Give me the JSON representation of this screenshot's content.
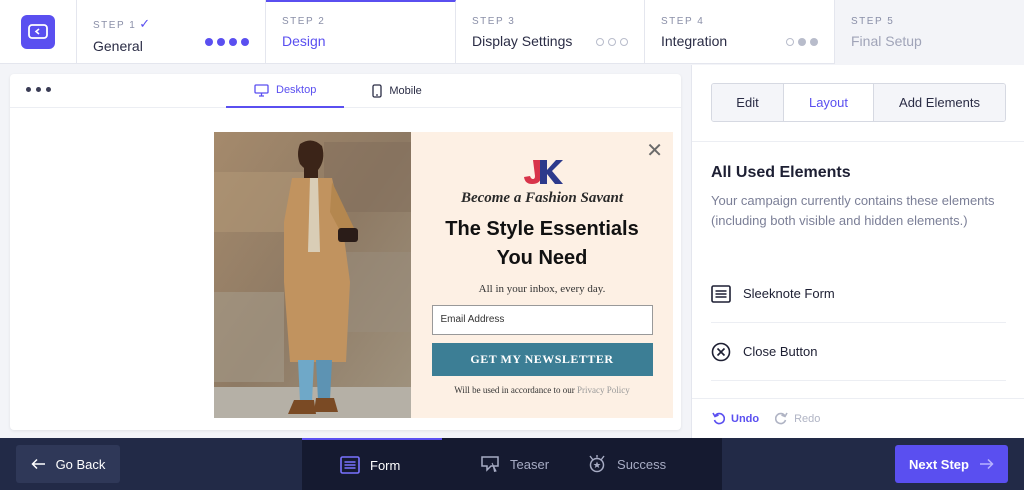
{
  "steps": [
    {
      "num": "STEP 1",
      "title": "General",
      "check": "✓"
    },
    {
      "num": "STEP 2",
      "title": "Design"
    },
    {
      "num": "STEP 3",
      "title": "Display Settings"
    },
    {
      "num": "STEP 4",
      "title": "Integration"
    },
    {
      "num": "STEP 5",
      "title": "Final Setup"
    }
  ],
  "preview": {
    "tabs": {
      "desktop": "Desktop",
      "mobile": "Mobile"
    },
    "popup": {
      "brand": "JK",
      "tagline": "Become a Fashion Savant",
      "headline_1": "The Style Essentials",
      "headline_2": "You Need",
      "sub": "All in your inbox, every day.",
      "email_placeholder": "Email Address",
      "cta": "GET MY NEWSLETTER",
      "legal_prefix": "Will be used in accordance to our",
      "legal_link": "Privacy Policy",
      "close": "✕"
    }
  },
  "sidebar": {
    "segments": {
      "edit": "Edit",
      "layout": "Layout",
      "add": "Add Elements"
    },
    "title": "All Used Elements",
    "description": "Your campaign currently contains these elements (including both visible and hidden elements.)",
    "elements": [
      {
        "label": "Sleeknote Form",
        "icon": "form-icon"
      },
      {
        "label": "Close Button",
        "icon": "close-circle-icon"
      }
    ],
    "undo": "Undo",
    "redo": "Redo"
  },
  "bottom": {
    "back": "Go Back",
    "tabs": {
      "form": "Form",
      "teaser": "Teaser",
      "success": "Success"
    },
    "next": "Next Step"
  },
  "colors": {
    "accent": "#5a4ff0",
    "bottom_bar": "#222a47",
    "cta": "#3c7e95",
    "popup_bg": "#fdf0e4"
  }
}
